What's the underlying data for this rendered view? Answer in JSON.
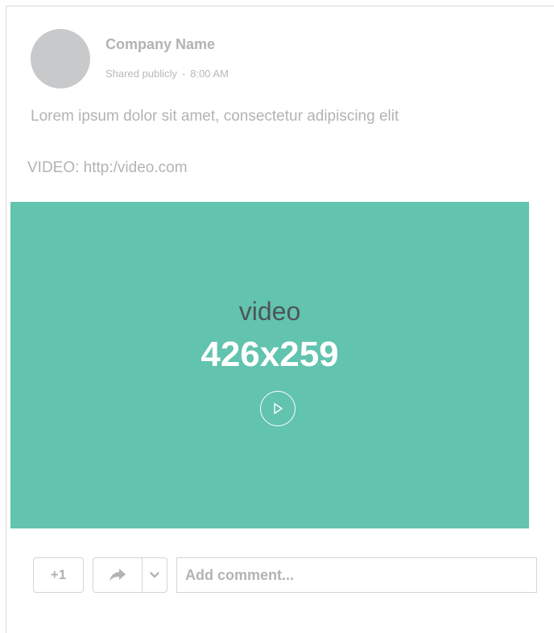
{
  "post": {
    "company_name": "Company Name",
    "visibility": "Shared publicly",
    "separator": "-",
    "time": "8:00 AM",
    "text": "Lorem ipsum dolor sit amet, consectetur adipiscing elit",
    "video_link": "VIDEO: http:/video.com"
  },
  "video": {
    "label": "video",
    "size": "426x259",
    "background_color": "#62c3ae",
    "play_icon": "play-icon"
  },
  "actions": {
    "plus_one_label": "+1",
    "share_icon": "share-arrow-icon",
    "dropdown_icon": "chevron-down-icon",
    "comment_placeholder": "Add comment..."
  }
}
